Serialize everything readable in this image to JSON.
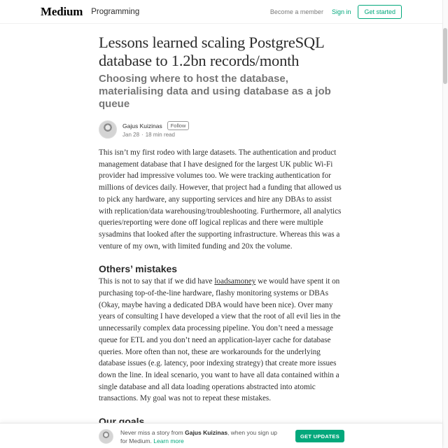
{
  "header": {
    "logo": "Medium",
    "publication": "Programming",
    "become_member": "Become a member",
    "sign_in": "Sign in",
    "get_started": "Get started"
  },
  "article": {
    "title": "Lessons learned scaling PostgreSQL database to 1.2bn records/month",
    "subtitle": "Choosing where to host the database, materialising data and using database as a job queue",
    "author": {
      "name": "Gajus Kuizinas",
      "follow_label": "Follow",
      "date": "Jan 28",
      "read_time": "18 min read"
    },
    "paragraph1": "This isn’t my first rodeo with large datasets. The authentication and product management database that I have designed for the largest UK public Wi-Fi provider had impressive volumes too. We were tracking authentication for millions of devices daily. However, that project had a funding that allowed us to pick any hardware, any supporting services and hire any DBAs to assist with replication/data warehousing/troubleshooting. Furthermore, all analytics queries/reporting were done off logical replicas and there were multiple sysadmins that looked after the supporting infrastructure. Whereas this was a venture of my own, with limited funding and 20x the volume.",
    "heading1": "Others’ mistakes",
    "paragraph2_before_link": "This is not to say that if we did have ",
    "paragraph2_link": "loadsamoney",
    "paragraph2_after_link": " we would have spent it on purchasing top-of-the-line hardware, flashy monitoring systems or DBAs (Okay, maybe having a dedicated DBA would have been nice). Over many years of consulting I have developed a view that the root of all evil lies in the unnecessarily complex data processing pipeline. You don’t need a message queue for ETL and you don’t need an application-layer cache for database queries. More often than not, these are workarounds for the underlying database issues (e.g. latency, poor indexing strategy) that create more issues down the line. In ideal scenario, you want to have all data contained within a single database and all data loading operations abstracted into atomic transactions. My goal was not to repeat these mistakes.",
    "heading2": "Our goals"
  },
  "banner": {
    "text_prefix": "Never miss a story from ",
    "author": "Gajus Kuizinas",
    "text_middle": ", when you sign up for Medium. ",
    "learn_more": "Learn more",
    "button": "GET UPDATES"
  },
  "colors": {
    "accent": "#03a87c",
    "text": "rgba(0,0,0,0.84)",
    "muted": "rgba(0,0,0,0.54)"
  }
}
